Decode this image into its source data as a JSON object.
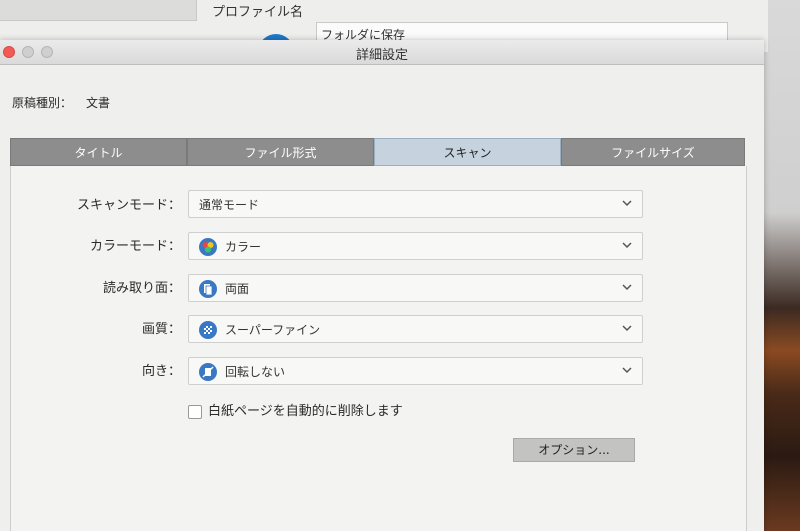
{
  "background_window": {
    "profile_label": "プロファイル名",
    "folder_field": "フォルダに保存"
  },
  "dialog": {
    "title": "詳細設定",
    "doc_type_label": "原稿種別：",
    "doc_type_value": "文書"
  },
  "tabs": [
    {
      "label": "タイトル",
      "active": false
    },
    {
      "label": "ファイル形式",
      "active": false
    },
    {
      "label": "スキャン",
      "active": true
    },
    {
      "label": "ファイルサイズ",
      "active": false
    }
  ],
  "settings": [
    {
      "label": "スキャンモード：",
      "value": "通常モード",
      "icon": null
    },
    {
      "label": "カラーモード：",
      "value": "カラー",
      "icon": "color-mode-icon"
    },
    {
      "label": "読み取り面：",
      "value": "両面",
      "icon": "duplex-icon"
    },
    {
      "label": "画質：",
      "value": "スーパーファイン",
      "icon": "quality-icon"
    },
    {
      "label": "向き：",
      "value": "回転しない",
      "icon": "rotation-icon"
    }
  ],
  "blank_page_checkbox": {
    "label": "白紙ページを自動的に削除します",
    "checked": false
  },
  "options_button": "オプション..."
}
